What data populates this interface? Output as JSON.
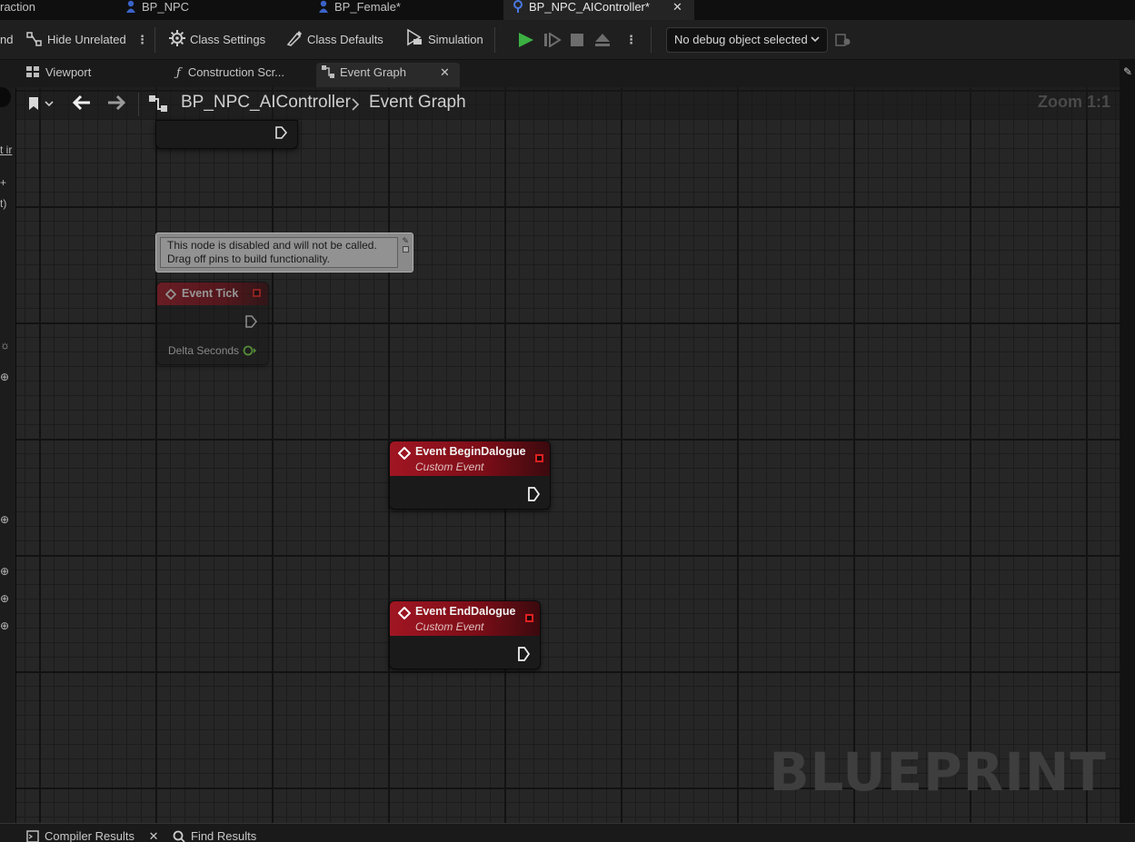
{
  "doc_tabs": [
    {
      "label": "raction"
    },
    {
      "label": "BP_NPC"
    },
    {
      "label": "BP_Female*"
    },
    {
      "label": "BP_NPC_AIController*",
      "active": true
    }
  ],
  "toolbar": {
    "cut_label": "nd",
    "hide_unrelated": "Hide Unrelated",
    "class_settings": "Class Settings",
    "class_defaults": "Class Defaults",
    "simulation": "Simulation",
    "debug_select": "No debug object selected"
  },
  "panel_tabs": [
    {
      "label": "Viewport"
    },
    {
      "label": "Construction Scr..."
    },
    {
      "label": "Event Graph",
      "active": true
    }
  ],
  "left_strip": {
    "t1": "t ir",
    "t2": "t)"
  },
  "graph": {
    "breadcrumb": {
      "blueprint": "BP_NPC_AIController",
      "graph": "Event Graph"
    },
    "zoom": "Zoom 1:1",
    "watermark": "BLUEPRINT",
    "tooltip": {
      "line1": "This node is disabled and will not be called.",
      "line2": "Drag off pins to build functionality."
    },
    "nodes": {
      "tick": {
        "title": "Event Tick",
        "pin_label": "Delta Seconds",
        "disabled": true
      },
      "begin": {
        "title": "Event BeginDalogue",
        "subtitle": "Custom Event"
      },
      "end": {
        "title": "Event EndDalogue",
        "subtitle": "Custom Event"
      }
    }
  },
  "bottom_tabs": [
    {
      "label": "Compiler Results"
    },
    {
      "label": "Find Results"
    }
  ],
  "colors": {
    "event_header": "#a01622",
    "play_green": "#3cb043",
    "grid_bg": "#262626"
  }
}
